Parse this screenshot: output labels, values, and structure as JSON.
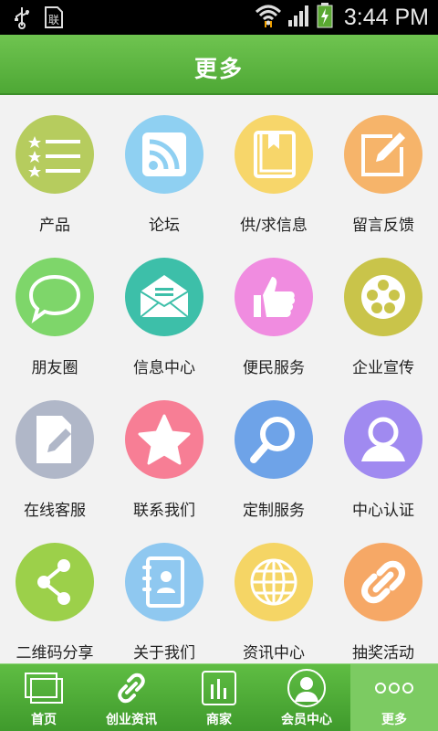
{
  "status": {
    "time": "3:44 PM"
  },
  "header": {
    "title": "更多"
  },
  "grid": [
    {
      "label": "产品",
      "icon": "list-stars-icon",
      "color": "#b6cc5e"
    },
    {
      "label": "论坛",
      "icon": "rss-icon",
      "color": "#8fd0f2"
    },
    {
      "label": "供/求信息",
      "icon": "book-icon",
      "color": "#f7d66a"
    },
    {
      "label": "留言反馈",
      "icon": "edit-icon",
      "color": "#f6b46a"
    },
    {
      "label": "朋友圈",
      "icon": "speech-bubble-icon",
      "color": "#7ed66a"
    },
    {
      "label": "信息中心",
      "icon": "envelope-icon",
      "color": "#3dbfa9"
    },
    {
      "label": "便民服务",
      "icon": "thumbs-up-icon",
      "color": "#f08ce0"
    },
    {
      "label": "企业宣传",
      "icon": "film-reel-icon",
      "color": "#c9c44a"
    },
    {
      "label": "在线客服",
      "icon": "document-pen-icon",
      "color": "#b0b7c8"
    },
    {
      "label": "联系我们",
      "icon": "star-icon",
      "color": "#f77e95"
    },
    {
      "label": "定制服务",
      "icon": "magnifier-icon",
      "color": "#6ea3e8"
    },
    {
      "label": "中心认证",
      "icon": "user-icon",
      "color": "#a08af0"
    },
    {
      "label": "二维码分享",
      "icon": "share-icon",
      "color": "#9cd04a"
    },
    {
      "label": "关于我们",
      "icon": "contacts-icon",
      "color": "#8fc8f0"
    },
    {
      "label": "资讯中心",
      "icon": "globe-icon",
      "color": "#f5d565"
    },
    {
      "label": "抽奖活动",
      "icon": "link-icon",
      "color": "#f6a866"
    }
  ],
  "nav": [
    {
      "label": "首页",
      "icon": "windows-icon"
    },
    {
      "label": "创业资讯",
      "icon": "link-icon"
    },
    {
      "label": "商家",
      "icon": "bar-chart-icon"
    },
    {
      "label": "会员中心",
      "icon": "person-icon"
    },
    {
      "label": "更多",
      "icon": "more-icon",
      "active": true
    }
  ]
}
